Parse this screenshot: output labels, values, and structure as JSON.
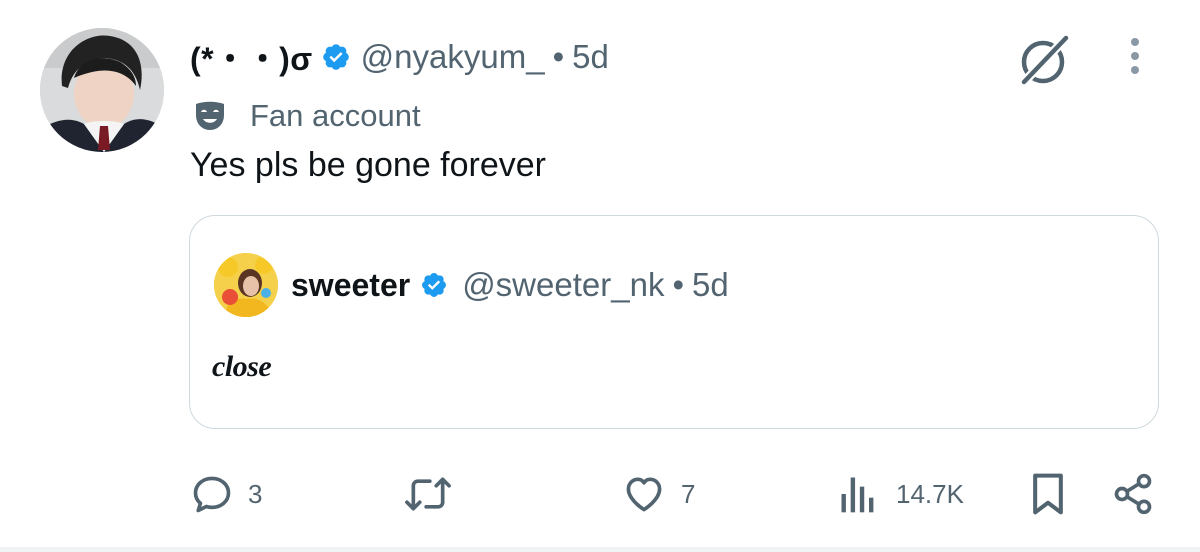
{
  "tweet": {
    "display_name": "(*・・)σ",
    "handle": "@nyakyum_",
    "separator": "•",
    "time": "5d",
    "label": "Fan account",
    "text": "Yes pls be gone forever",
    "verified_color": "#1d9bf0"
  },
  "quote": {
    "display_name": "sweeter",
    "handle": "@sweeter_nk",
    "separator": "•",
    "time": "5d",
    "text": "close"
  },
  "actions": {
    "replies": "3",
    "retweets": "",
    "likes": "7",
    "views": "14.7K"
  },
  "icons": {
    "grok": "grok-icon",
    "more": "more-icon",
    "label": "mask-icon",
    "reply": "reply-icon",
    "retweet": "retweet-icon",
    "like": "heart-icon",
    "views": "views-icon",
    "bookmark": "bookmark-icon",
    "share": "share-icon"
  },
  "colors": {
    "text_primary": "#0f1419",
    "text_secondary": "#536471",
    "border": "#cfd9de",
    "accent": "#1d9bf0"
  }
}
